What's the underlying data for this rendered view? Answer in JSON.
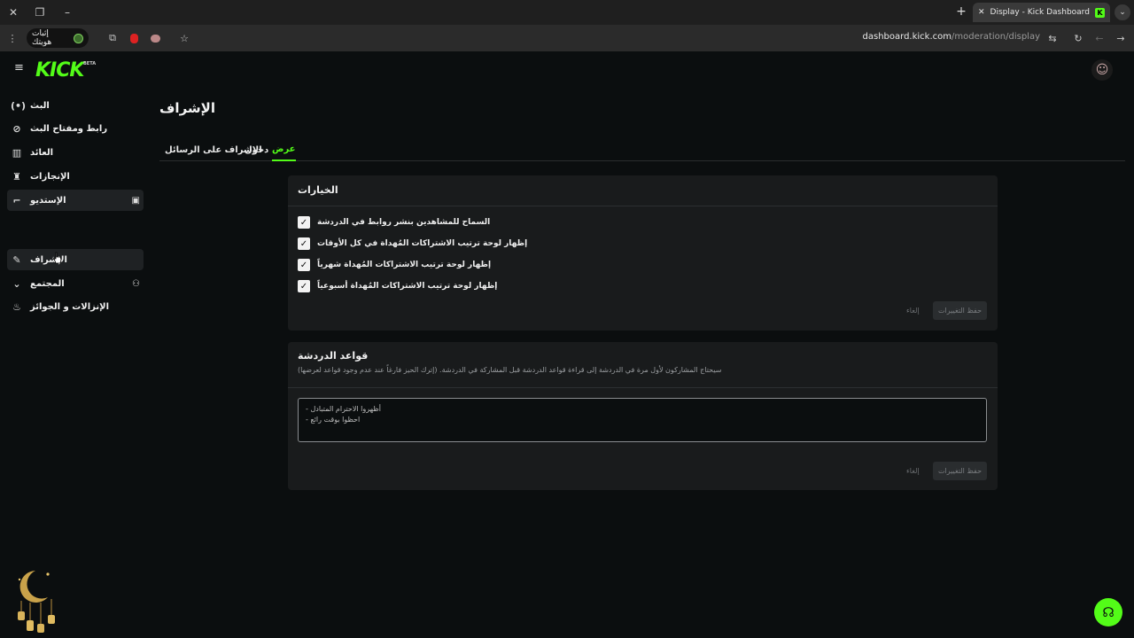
{
  "browser": {
    "tab_title": "Display - Kick Dashboard",
    "tab_favicon": "K",
    "verify_label": "إثبات هويتك",
    "url_domain": "dashboard.kick.com",
    "url_path": "/moderation/display"
  },
  "header": {
    "logo": "KICK",
    "beta": "BETA"
  },
  "sidebar": {
    "items": [
      {
        "label": "البث",
        "icon": "broadcast-icon"
      },
      {
        "label": "رابط ومفتاح البث",
        "icon": "link-icon"
      },
      {
        "label": "العائد",
        "icon": "chart-icon"
      },
      {
        "label": "الإنجازات",
        "icon": "trophy-icon"
      },
      {
        "label": "الإستديو",
        "icon": "studio-icon"
      },
      {
        "label": "الإشراف",
        "icon": "wrench-icon"
      },
      {
        "label": "المجتمع",
        "icon": "community-icon"
      },
      {
        "label": "الإنزالات و الجوائز",
        "icon": "cake-icon"
      }
    ]
  },
  "main": {
    "title": "الإشراف",
    "tabs": [
      {
        "label": "الإشراف على الرسائل"
      },
      {
        "label": "دخول"
      },
      {
        "label": "عرض"
      }
    ]
  },
  "options_card": {
    "title": "الخيارات",
    "options": [
      {
        "label": "السماح للمشاهدين بنشر روابط في الدردشة",
        "checked": true
      },
      {
        "label": "إظهار لوحة ترتيب الاشتراكات المُهداة في كل الأوقات",
        "checked": true
      },
      {
        "label": "إظهار لوحة ترتيب الاشتراكات المُهداة شهرياً",
        "checked": true
      },
      {
        "label": "إظهار لوحة ترتيب الاشتراكات المُهداة أسبوعياً",
        "checked": true
      }
    ],
    "save_label": "حفظ التغييرات",
    "cancel_label": "إلغاء"
  },
  "rules_card": {
    "title": "قواعد الدردشة",
    "description": "سيحتاج المشاركون لأول مرة في الدردشة إلى قراءة قواعد الدردشة قبل المشاركة في الدردشة. (إترك الحيز فارغاً عند عدم وجود قواعد لعرضها)",
    "rules_line1": "- أظهروا الاحترام المتبادل",
    "rules_line2": "- احظوا بوقت رائع",
    "save_label": "حفظ التغييرات",
    "cancel_label": "إلغاء"
  },
  "colors": {
    "accent": "#53fc18",
    "background": "#0b0e0f",
    "card": "#191b1c"
  }
}
